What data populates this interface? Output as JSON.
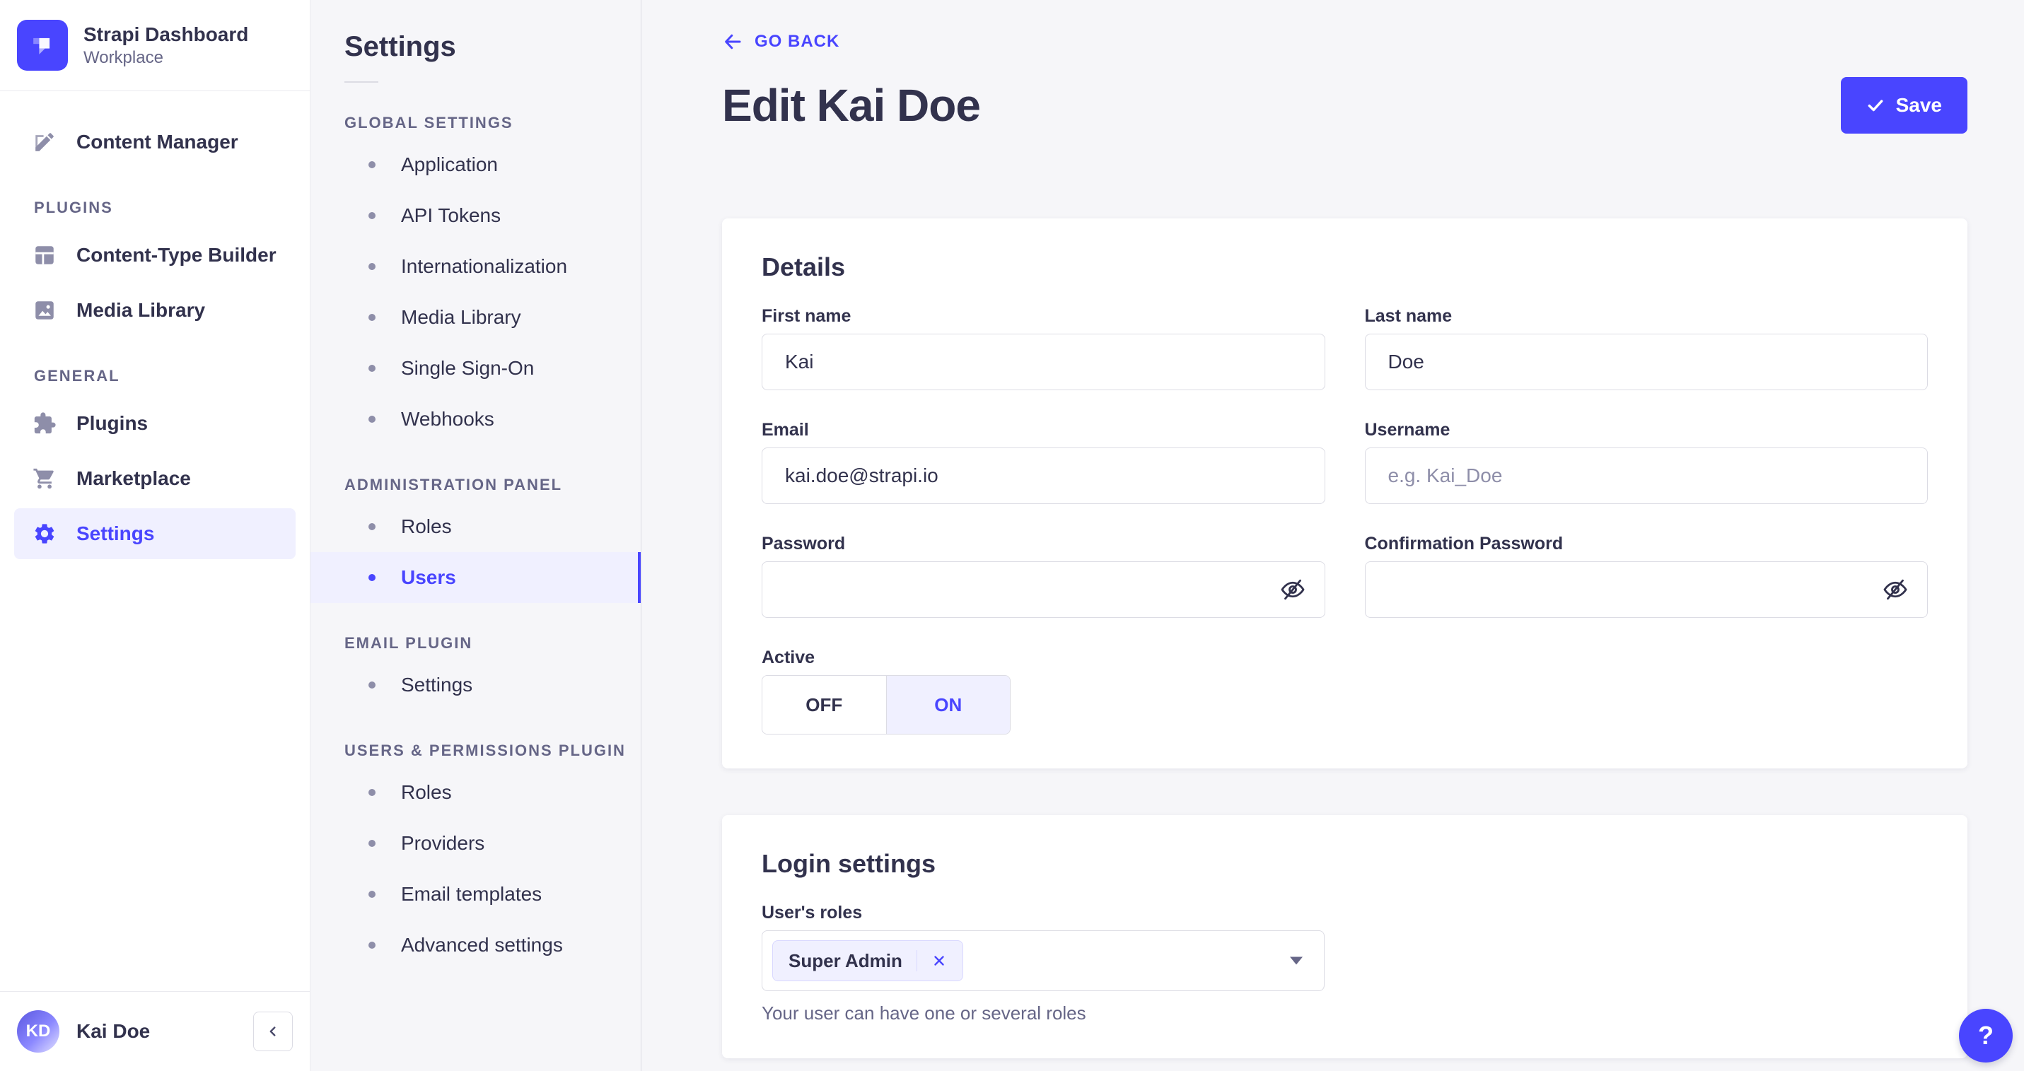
{
  "colors": {
    "primary": "#4945ff",
    "primary_light": "#f0f0ff",
    "tag_border": "#d9d8ff",
    "text": "#32324d",
    "muted": "#666687",
    "border": "#dcdce4",
    "page_bg": "#f6f6f9",
    "surface": "#ffffff"
  },
  "sidebar": {
    "brand": {
      "name": "Strapi Dashboard",
      "workspace": "Workplace",
      "logo_icon": "strapi-logo"
    },
    "top_items": [
      {
        "label": "Content Manager",
        "icon": "content-manager-icon"
      }
    ],
    "sections": [
      {
        "label": "PLUGINS",
        "items": [
          {
            "label": "Content-Type Builder",
            "icon": "layout-icon",
            "active": false
          },
          {
            "label": "Media Library",
            "icon": "picture-icon",
            "active": false
          }
        ]
      },
      {
        "label": "GENERAL",
        "items": [
          {
            "label": "Plugins",
            "icon": "puzzle-icon",
            "active": false
          },
          {
            "label": "Marketplace",
            "icon": "cart-icon",
            "active": false
          },
          {
            "label": "Settings",
            "icon": "gear-icon",
            "active": true
          }
        ]
      }
    ],
    "user": {
      "initials": "KD",
      "name": "Kai Doe"
    }
  },
  "subnav": {
    "title": "Settings",
    "sections": [
      {
        "label": "GLOBAL SETTINGS",
        "items": [
          {
            "label": "Application",
            "active": false
          },
          {
            "label": "API Tokens",
            "active": false
          },
          {
            "label": "Internationalization",
            "active": false
          },
          {
            "label": "Media Library",
            "active": false
          },
          {
            "label": "Single Sign-On",
            "active": false
          },
          {
            "label": "Webhooks",
            "active": false
          }
        ]
      },
      {
        "label": "ADMINISTRATION PANEL",
        "items": [
          {
            "label": "Roles",
            "active": false
          },
          {
            "label": "Users",
            "active": true
          }
        ]
      },
      {
        "label": "EMAIL PLUGIN",
        "items": [
          {
            "label": "Settings",
            "active": false
          }
        ]
      },
      {
        "label": "USERS & PERMISSIONS PLUGIN",
        "items": [
          {
            "label": "Roles",
            "active": false
          },
          {
            "label": "Providers",
            "active": false
          },
          {
            "label": "Email templates",
            "active": false
          },
          {
            "label": "Advanced settings",
            "active": false
          }
        ]
      }
    ]
  },
  "header": {
    "back_label": "GO BACK",
    "title": "Edit Kai Doe",
    "save_label": "Save"
  },
  "details": {
    "title": "Details",
    "fields": {
      "first_name": {
        "label": "First name",
        "value": "Kai"
      },
      "last_name": {
        "label": "Last name",
        "value": "Doe"
      },
      "email": {
        "label": "Email",
        "value": "kai.doe@strapi.io"
      },
      "username": {
        "label": "Username",
        "placeholder": "e.g. Kai_Doe",
        "value": ""
      },
      "password": {
        "label": "Password",
        "value": ""
      },
      "confirmation_password": {
        "label": "Confirmation Password",
        "value": ""
      },
      "active": {
        "label": "Active",
        "off_label": "OFF",
        "on_label": "ON",
        "value": "ON"
      }
    }
  },
  "login_settings": {
    "title": "Login settings",
    "roles": {
      "label": "User's roles",
      "tags": [
        {
          "label": "Super Admin"
        }
      ],
      "hint": "Your user can have one or several roles"
    }
  },
  "help": {
    "label": "?"
  }
}
